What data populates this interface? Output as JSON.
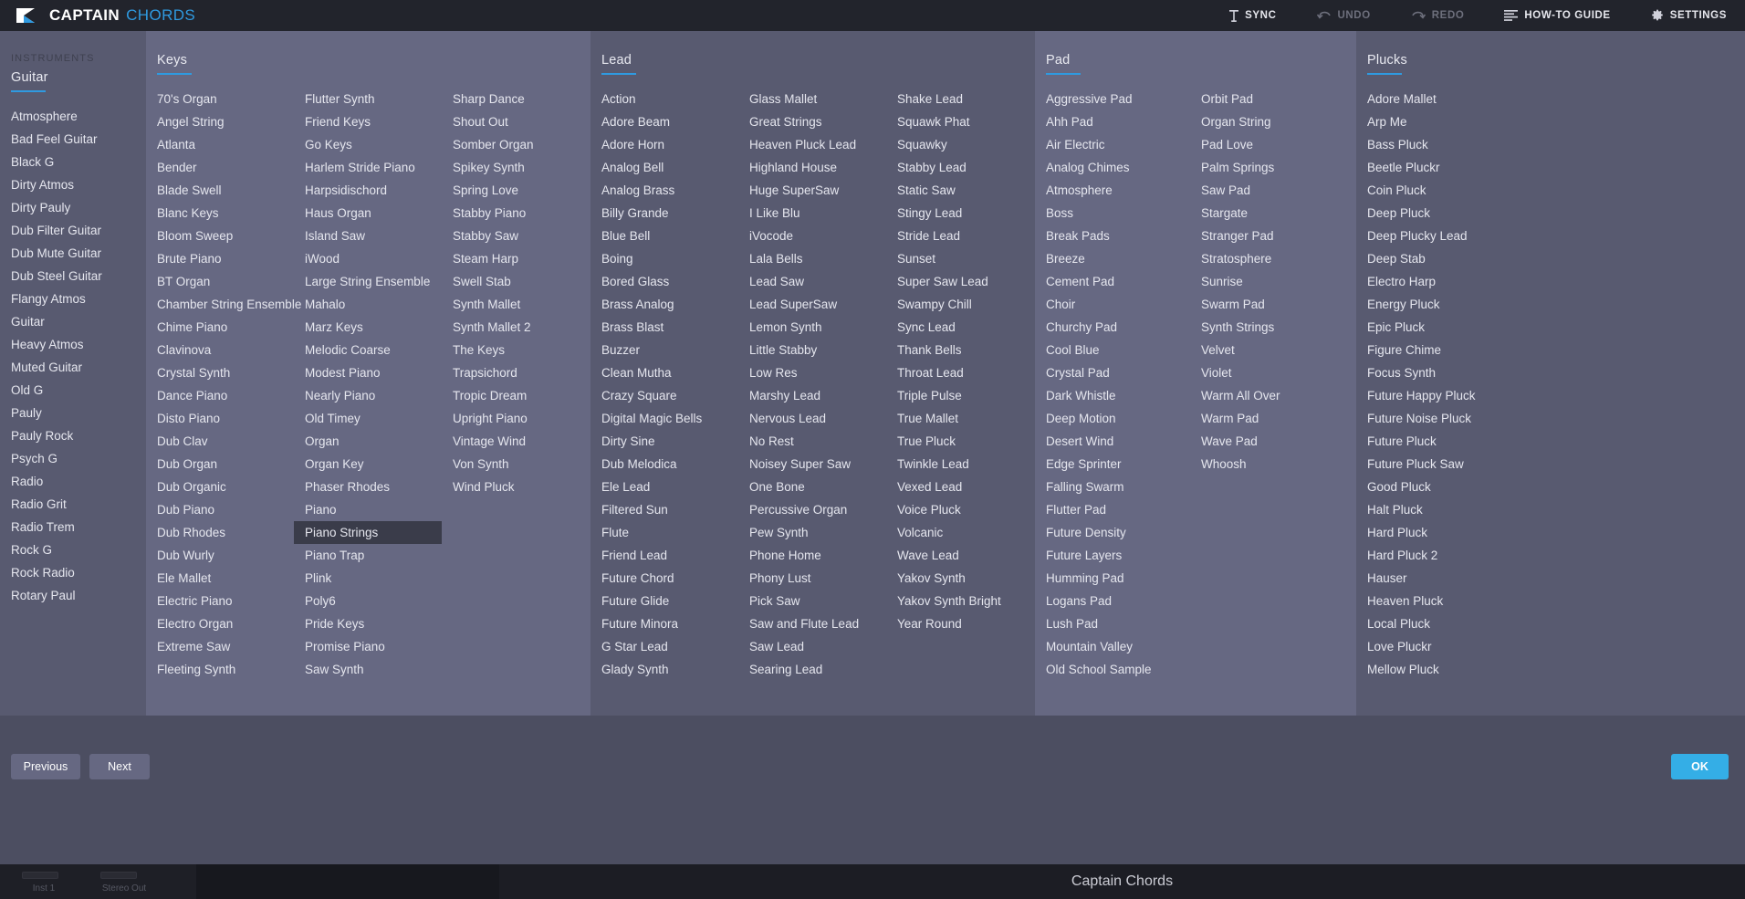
{
  "app": {
    "brand_primary": "CAPTAIN",
    "brand_secondary": "CHORDS",
    "accent_color": "#2f9ae0",
    "ok_color": "#34aee6"
  },
  "toolbar": {
    "items": [
      {
        "label": "SYNC",
        "icon": "sync-icon",
        "enabled": true
      },
      {
        "label": "UNDO",
        "icon": "undo-icon",
        "enabled": false
      },
      {
        "label": "REDO",
        "icon": "redo-icon",
        "enabled": false
      },
      {
        "label": "HOW-TO GUIDE",
        "icon": "guide-icon",
        "enabled": true
      },
      {
        "label": "SETTINGS",
        "icon": "gear-icon",
        "enabled": true
      }
    ]
  },
  "sidebar": {
    "section_label": "INSTRUMENTS",
    "title": "Guitar",
    "items": [
      "Atmosphere",
      "Bad Feel Guitar",
      "Black G",
      "Dirty Atmos",
      "Dirty Pauly",
      "Dub Filter Guitar",
      "Dub Mute Guitar",
      "Dub Steel Guitar",
      "Flangy Atmos",
      "Guitar",
      "Heavy Atmos",
      "Muted Guitar",
      "Old G",
      "Pauly",
      "Pauly Rock",
      "Psych G",
      "Radio",
      "Radio Grit",
      "Radio Trem",
      "Rock G",
      "Rock Radio",
      "Rotary Paul"
    ]
  },
  "categories": [
    {
      "title": "Keys",
      "selected": "Piano Strings",
      "subcolumns": [
        [
          "70's Organ",
          "Angel String",
          "Atlanta",
          "Bender",
          "Blade Swell",
          "Blanc Keys",
          "Bloom Sweep",
          "Brute Piano",
          "BT Organ",
          "Chamber String Ensemble",
          "Chime Piano",
          "Clavinova",
          "Crystal Synth",
          "Dance Piano",
          "Disto Piano",
          "Dub Clav",
          "Dub Organ",
          "Dub Organic",
          "Dub Piano",
          "Dub Rhodes",
          "Dub Wurly",
          "Ele Mallet",
          "Electric Piano",
          "Electro Organ",
          "Extreme Saw",
          "Fleeting Synth"
        ],
        [
          "Flutter Synth",
          "Friend Keys",
          "Go Keys",
          "Harlem Stride Piano",
          "Harpsidischord",
          "Haus Organ",
          "Island Saw",
          "iWood",
          "Large String Ensemble",
          "Mahalo",
          "Marz Keys",
          "Melodic Coarse",
          "Modest Piano",
          "Nearly Piano",
          "Old Timey",
          "Organ",
          "Organ Key",
          "Phaser Rhodes",
          "Piano",
          "Piano Strings",
          "Piano Trap",
          "Plink",
          "Poly6",
          "Pride Keys",
          "Promise Piano",
          "Saw Synth"
        ],
        [
          "Sharp Dance",
          "Shout Out",
          "Somber Organ",
          "Spikey Synth",
          "Spring Love",
          "Stabby Piano",
          "Stabby Saw",
          "Steam Harp",
          "Swell Stab",
          "Synth Mallet",
          "Synth Mallet 2",
          "The Keys",
          "Trapsichord",
          "Tropic Dream",
          "Upright Piano",
          "Vintage Wind",
          "Von Synth",
          "Wind Pluck"
        ]
      ]
    },
    {
      "title": "Lead",
      "selected": "",
      "subcolumns": [
        [
          "Action",
          "Adore Beam",
          "Adore Horn",
          "Analog Bell",
          "Analog Brass",
          "Billy Grande",
          "Blue Bell",
          "Boing",
          "Bored Glass",
          "Brass Analog",
          "Brass Blast",
          "Buzzer",
          "Clean Mutha",
          "Crazy Square",
          "Digital Magic Bells",
          "Dirty Sine",
          "Dub Melodica",
          "Ele Lead",
          "Filtered Sun",
          "Flute",
          "Friend Lead",
          "Future Chord",
          "Future Glide",
          "Future Minora",
          "G Star Lead",
          "Glady Synth"
        ],
        [
          "Glass Mallet",
          "Great Strings",
          "Heaven Pluck Lead",
          "Highland House",
          "Huge SuperSaw",
          "I Like Blu",
          "iVocode",
          "Lala Bells",
          "Lead Saw",
          "Lead SuperSaw",
          "Lemon Synth",
          "Little Stabby",
          "Low Res",
          "Marshy Lead",
          "Nervous Lead",
          "No Rest",
          "Noisey Super Saw",
          "One Bone",
          "Percussive Organ",
          "Pew Synth",
          "Phone Home",
          "Phony Lust",
          "Pick Saw",
          "Saw and Flute Lead",
          "Saw Lead",
          "Searing Lead"
        ],
        [
          "Shake Lead",
          "Squawk Phat",
          "Squawky",
          "Stabby Lead",
          "Static Saw",
          "Stingy Lead",
          "Stride Lead",
          "Sunset",
          "Super Saw Lead",
          "Swampy Chill",
          "Sync Lead",
          "Thank Bells",
          "Throat Lead",
          "Triple Pulse",
          "True Mallet",
          "True Pluck",
          "Twinkle Lead",
          "Vexed Lead",
          "Voice Pluck",
          "Volcanic",
          "Wave Lead",
          "Yakov Synth",
          "Yakov Synth Bright",
          "Year Round"
        ]
      ]
    },
    {
      "title": "Pad",
      "selected": "",
      "subcolumns": [
        [
          "Aggressive Pad",
          "Ahh Pad",
          "Air Electric",
          "Analog Chimes",
          "Atmosphere",
          "Boss",
          "Break Pads",
          "Breeze",
          "Cement Pad",
          "Choir",
          "Churchy Pad",
          "Cool Blue",
          "Crystal Pad",
          "Dark Whistle",
          "Deep Motion",
          "Desert Wind",
          "Edge Sprinter",
          "Falling Swarm",
          "Flutter Pad",
          "Future Density",
          "Future Layers",
          "Humming Pad",
          "Logans Pad",
          "Lush Pad",
          "Mountain Valley",
          "Old School Sample"
        ],
        [
          "Orbit Pad",
          "Organ String",
          "Pad Love",
          "Palm Springs",
          "Saw Pad",
          "Stargate",
          "Stranger Pad",
          "Stratosphere",
          "Sunrise",
          "Swarm Pad",
          "Synth Strings",
          "Velvet",
          "Violet",
          "Warm All Over",
          "Warm Pad",
          "Wave Pad",
          "Whoosh"
        ]
      ]
    },
    {
      "title": "Plucks",
      "selected": "",
      "subcolumns": [
        [
          "Adore Mallet",
          "Arp Me",
          "Bass Pluck",
          "Beetle Pluckr",
          "Coin Pluck",
          "Deep Pluck",
          "Deep Plucky Lead",
          "Deep Stab",
          "Electro Harp",
          "Energy Pluck",
          "Epic Pluck",
          "Figure Chime",
          "Focus Synth",
          "Future Happy Pluck",
          "Future Noise Pluck",
          "Future Pluck",
          "Future Pluck Saw",
          "Good Pluck",
          "Halt Pluck",
          "Hard Pluck",
          "Hard Pluck 2",
          "Hauser",
          "Heaven Pluck",
          "Local Pluck",
          "Love Pluckr",
          "Mellow Pluck"
        ]
      ]
    }
  ],
  "actions": {
    "previous": "Previous",
    "next": "Next",
    "ok": "OK"
  },
  "host": {
    "slot1": "Inst 1",
    "slot2": "Stereo Out",
    "title": "Captain Chords"
  }
}
